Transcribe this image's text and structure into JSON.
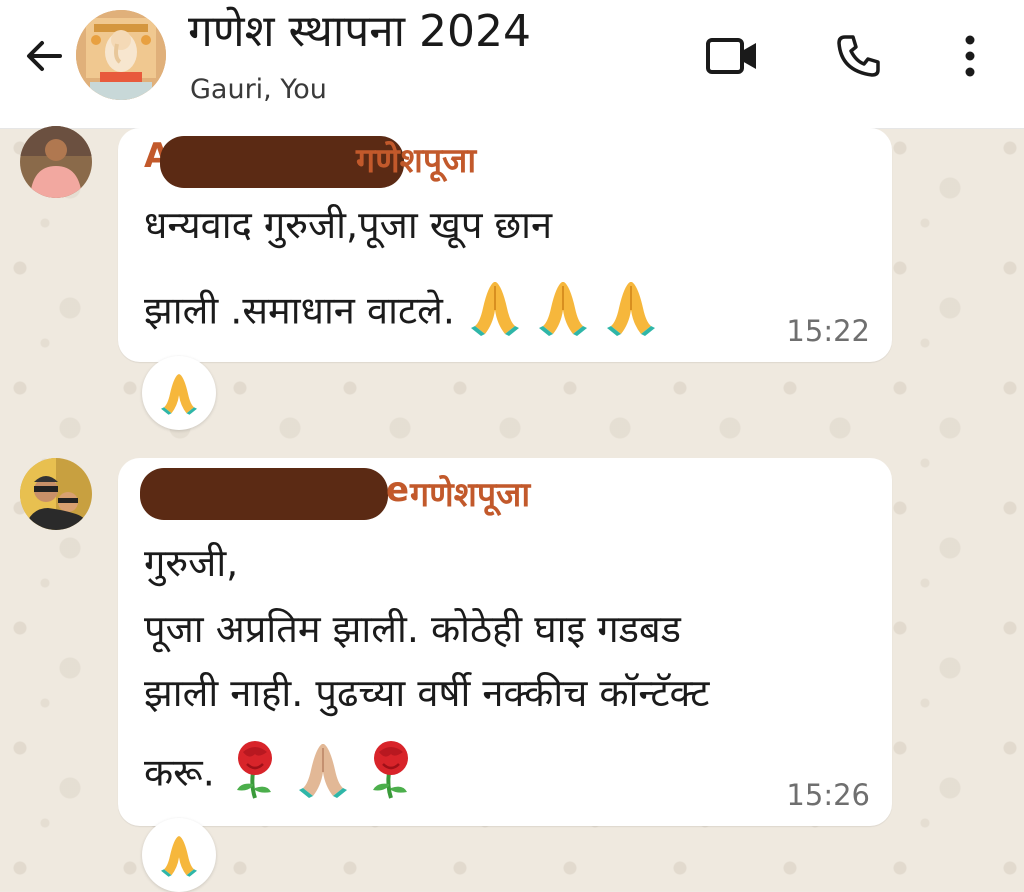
{
  "header": {
    "title": "गणेश स्थापना 2024",
    "subtitle": "Gauri, You"
  },
  "icons": {
    "back": "arrow-left-icon",
    "video": "video-camera-icon",
    "call": "phone-icon",
    "menu": "more-vertical-icon"
  },
  "messages": [
    {
      "sender_visible": "A",
      "sender_suffix": "गणेशपूजा",
      "lines": [
        "धन्यवाद गुरुजी,पूजा खूप  छान",
        "झाली .समाधान वाटले."
      ],
      "time": "15:22",
      "reaction": "folded-hands-emoji"
    },
    {
      "sender_visible": "e",
      "sender_suffix": "गणेशपूजा",
      "lines": [
        "गुरुजी,",
        "पूजा अप्रतिम झाली. कोठेही घाइ गडबड",
        "झाली नाही. पुढच्या वर्षी नक्कीच कॉन्टॅक्ट",
        "करू."
      ],
      "time": "15:26",
      "reaction": "folded-hands-emoji"
    }
  ],
  "colors": {
    "sender_name": "#c2592b",
    "bubble": "#ffffff",
    "wallpaper": "#efe9df",
    "redaction": "#5b2a14"
  }
}
